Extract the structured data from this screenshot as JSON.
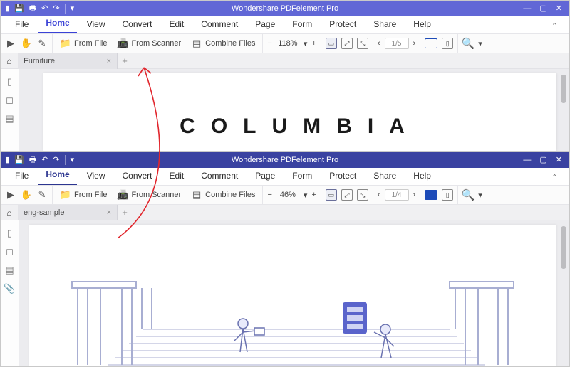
{
  "app_title": "Wondershare PDFelement Pro",
  "menus": {
    "file": "File",
    "home": "Home",
    "view": "View",
    "convert": "Convert",
    "edit": "Edit",
    "comment": "Comment",
    "page": "Page",
    "form": "Form",
    "protect": "Protect",
    "share": "Share",
    "help": "Help"
  },
  "toolbar": {
    "from_file": "From File",
    "from_scanner": "From Scanner",
    "combine_files": "Combine Files"
  },
  "windows": {
    "top": {
      "tab_name": "Furniture",
      "zoom": "118%",
      "page": "1/5",
      "headline": "COLUMBIA"
    },
    "bot": {
      "tab_name": "eng-sample",
      "zoom": "46%",
      "page": "1/4"
    }
  },
  "glyphs": {
    "minus": "−",
    "plus": "+",
    "chev_down": "▾",
    "chev_left": "‹",
    "chev_right": "›",
    "close": "×",
    "search": "🔍",
    "min": "—",
    "square": "▢",
    "x": "✕"
  }
}
